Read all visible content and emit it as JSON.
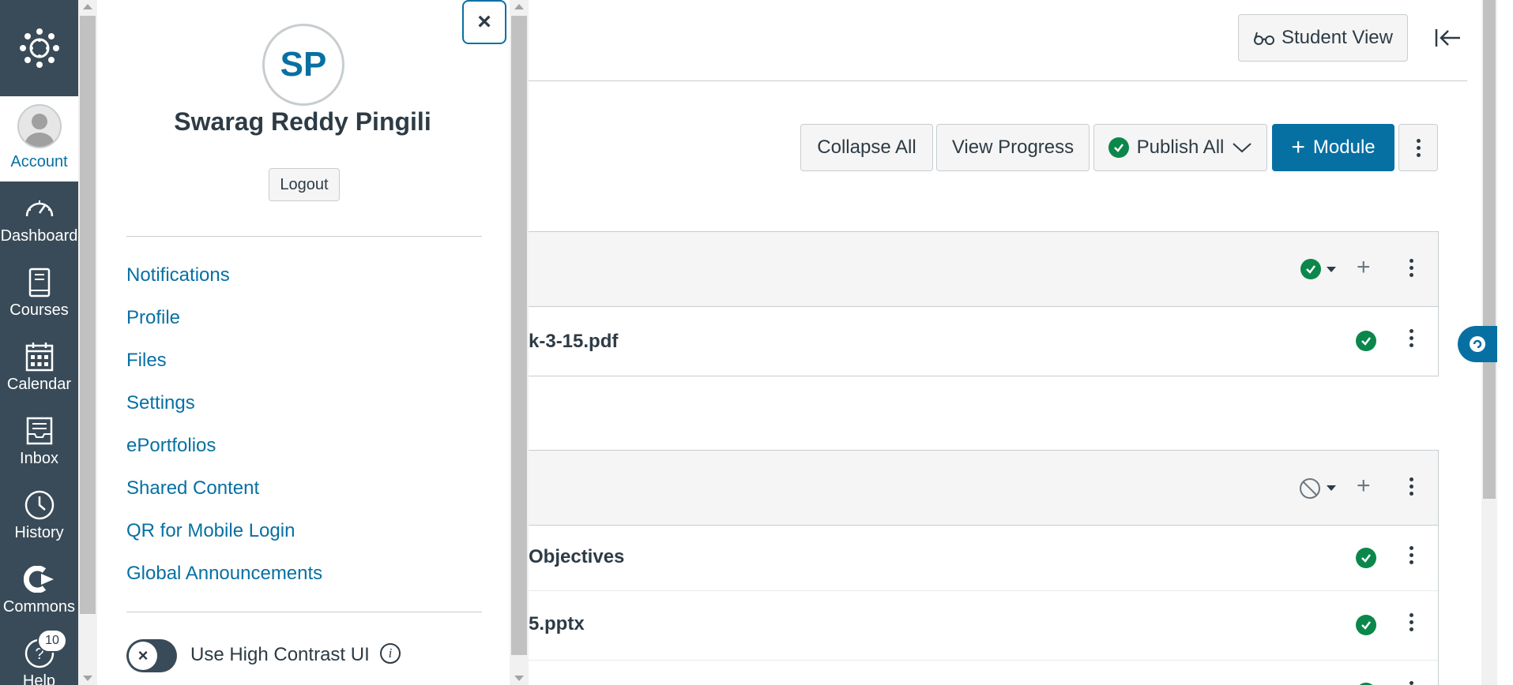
{
  "nav": {
    "account_label": "Account",
    "items": [
      {
        "label": "Dashboard",
        "icon": "dashboard-icon"
      },
      {
        "label": "Courses",
        "icon": "courses-icon"
      },
      {
        "label": "Calendar",
        "icon": "calendar-icon"
      },
      {
        "label": "Inbox",
        "icon": "inbox-icon"
      },
      {
        "label": "History",
        "icon": "history-icon"
      },
      {
        "label": "Commons",
        "icon": "commons-icon"
      },
      {
        "label": "Help",
        "icon": "help-icon"
      }
    ],
    "help_badge": "10"
  },
  "tray": {
    "close_symbol": "×",
    "initials": "SP",
    "user_name": "Swarag Reddy Pingili",
    "logout_label": "Logout",
    "links": [
      "Notifications",
      "Profile",
      "Files",
      "Settings",
      "ePortfolios",
      "Shared Content",
      "QR for Mobile Login",
      "Global Announcements"
    ],
    "high_contrast_label": "Use High Contrast UI",
    "toggle_symbol": "×",
    "info_symbol": "i"
  },
  "header": {
    "student_view_label": "Student View"
  },
  "toolbar": {
    "collapse_all": "Collapse All",
    "view_progress": "View Progress",
    "publish_all": "Publish All",
    "add_module": "Module"
  },
  "modules": [
    {
      "status": "published",
      "items": [
        {
          "title": "k-3-15.pdf",
          "status": "published"
        }
      ]
    },
    {
      "status": "unpublished",
      "items": [
        {
          "title": "Objectives",
          "status": "published"
        },
        {
          "title": "5.pptx",
          "status": "published"
        }
      ]
    }
  ],
  "colors": {
    "nav_bg": "#394b58",
    "link_blue": "#0770a3",
    "publish_green": "#0b874b",
    "text": "#2d3b45"
  }
}
